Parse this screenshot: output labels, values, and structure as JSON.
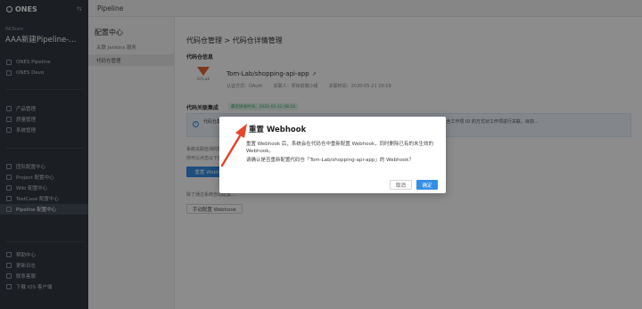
{
  "app": {
    "logo": "ONES",
    "team_label": "WLTeam",
    "project_title": "AAA新建Pipeline-..."
  },
  "nav_groups": [
    [
      "ONES Pipeline",
      "ONES Devo"
    ],
    [
      "产品管理",
      "质量管理",
      "系统管理"
    ],
    [
      "团队配置中心",
      "Project 配置中心",
      "Wiki 配置中心",
      "TestCase 配置中心",
      "Pipeline 配置中心"
    ],
    [
      "帮助中心",
      "更新日志",
      "联系客服",
      "下载 iOS 客户端"
    ]
  ],
  "nav_active": "Pipeline 配置中心",
  "topbar_title": "Pipeline",
  "sub_nav": {
    "title": "配置中心",
    "items": [
      "关联 Jenkins 服务",
      "代码仓管理"
    ],
    "active": "代码仓管理"
  },
  "main": {
    "breadcrumb": "代码仓管理 > 代码仓详情管理",
    "section_repo": "代码仓信息",
    "gitlab_label": "GitLab",
    "repo_name": "Tom-Lab/shopping-api-app",
    "repo_meta": [
      "认证方式：OAuth",
      "关联人：项目前端小组",
      "关联时间：2020-05-21 10:19"
    ],
    "section_webhook": "代码关联集成",
    "status_badge": "最近接收时间：2020-05-22 08:18",
    "notice_text": "代码仓集成可对 Tom-Lab/shopping-api-app 代码仓进行关联后……在提交信息（commit message）的时候通过输入包含工作项 ID 的方式对工作项进行关联，目前…",
    "desc_1": "系统关联检测的配置…",
    "desc_2": "你可以点击以下重置…",
    "reset_button": "重置 Webhook",
    "desc_3": "除了通过系统自动配置…",
    "manual_button": "手动配置 Webhook"
  },
  "dialog": {
    "title": "重置 Webhook",
    "body_1": "重置 Webhook 后，系统会在代码仓中重新配置 Webhook，同时删除已有的未生效的 Webhook。",
    "body_2": "请确认是否重新配置代码仓「Tom-Lab/shopping-api-app」的 Webhook？",
    "cancel": "取消",
    "confirm": "确定"
  }
}
